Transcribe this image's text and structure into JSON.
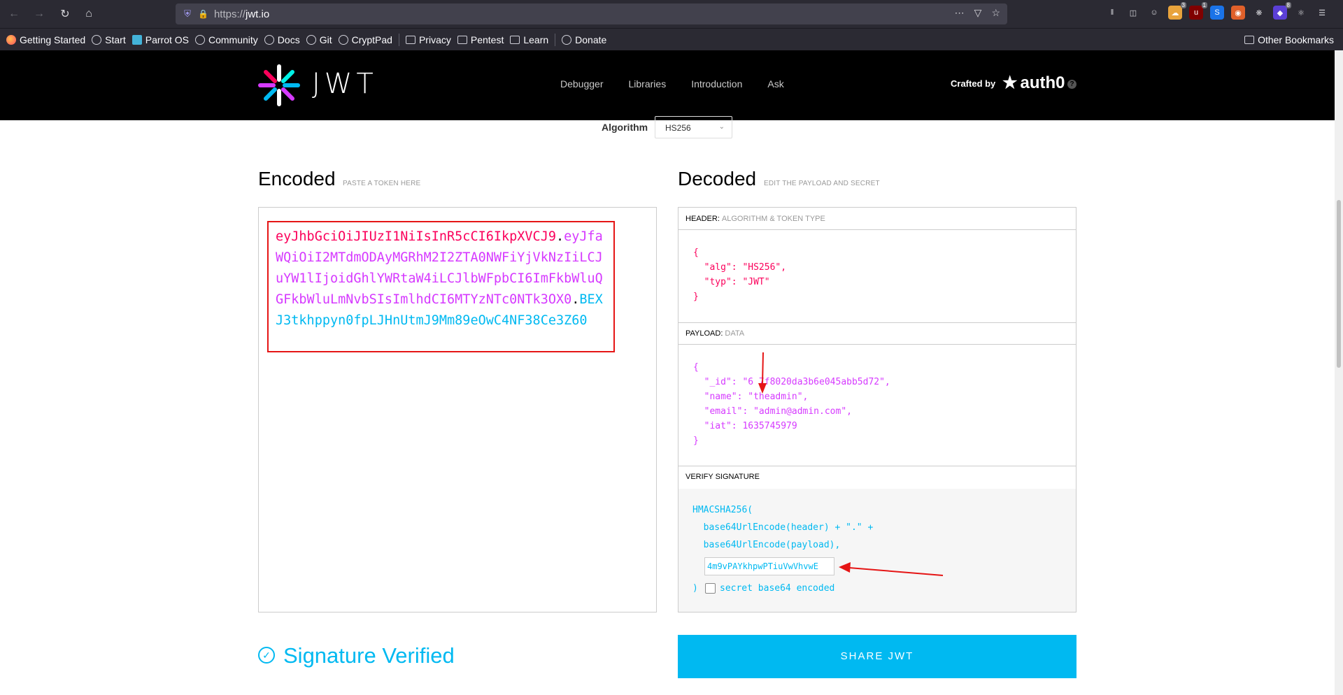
{
  "browser": {
    "url_prefix": "https://",
    "url_host": "jwt.io",
    "bookmarks": [
      "Getting Started",
      "Start",
      "Parrot OS",
      "Community",
      "Docs",
      "Git",
      "CryptPad"
    ],
    "bookmark_folders": [
      "Privacy",
      "Pentest",
      "Learn"
    ],
    "donate": "Donate",
    "other_bookmarks": "Other Bookmarks",
    "badge_counts": [
      "3",
      "1",
      "8"
    ]
  },
  "header": {
    "logo_text": "JWT",
    "menu": [
      "Debugger",
      "Libraries",
      "Introduction",
      "Ask"
    ],
    "crafted_by": "Crafted by",
    "auth0": "auth0",
    "help": "?"
  },
  "algorithm": {
    "label": "Algorithm",
    "value": "HS256"
  },
  "encoded": {
    "title": "Encoded",
    "subtitle": "PASTE A TOKEN HERE",
    "token_header": "eyJhbGciOiJIUzI1NiIsInR5cCI6IkpXVCJ9",
    "token_payload": "eyJfaWQiOiI2MTdmODAyMGRhM2I2ZTA0NWFiYjVkNzIiLCJuYW1lIjoidGhlYWRtaW4iLCJlbWFpbCI6ImFkbWluQGFkbWluLmNvbSIsImlhdCI6MTYzNTc0NTk3OX0",
    "token_signature": "BEXJ3tkhppyn0fpLJHnUtmJ9Mm89eOwC4NF38Ce3Z60",
    "dot": "."
  },
  "decoded": {
    "title": "Decoded",
    "subtitle": "EDIT THE PAYLOAD AND SECRET",
    "header_label": "HEADER:",
    "header_sub": "ALGORITHM & TOKEN TYPE",
    "header_json": "{\n  \"alg\": \"HS256\",\n  \"typ\": \"JWT\"\n}",
    "payload_label": "PAYLOAD:",
    "payload_sub": "DATA",
    "payload_json": "{\n  \"_id\": \"6 7f8020da3b6e045abb5d72\",\n  \"name\": \"theadmin\",\n  \"email\": \"admin@admin.com\",\n  \"iat\": 1635745979\n}",
    "verify_label": "VERIFY SIGNATURE",
    "verify_code": "HMACSHA256(\n  base64UrlEncode(header) + \".\" +\n  base64UrlEncode(payload),",
    "secret_value": "4m9vPAYkhpwPTiuVwVhvwE",
    "close_paren": ")",
    "secret_b64_label": "secret base64 encoded"
  },
  "footer": {
    "verified": "Signature Verified",
    "share": "SHARE JWT"
  },
  "colors": {
    "header": "#fb015b",
    "payload": "#d63aff",
    "signature": "#00b9f1",
    "annotation": "#e51515"
  }
}
